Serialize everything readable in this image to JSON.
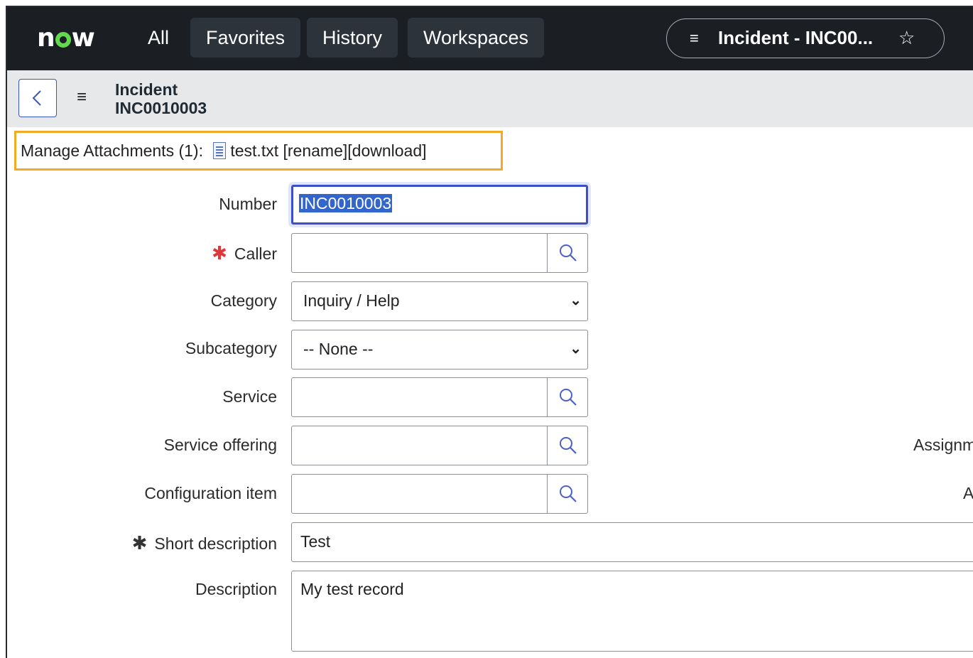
{
  "nav": {
    "logo_left": "n",
    "logo_right": "w",
    "items": [
      "All",
      "Favorites",
      "History",
      "Workspaces"
    ],
    "context_title": "Incident - INC00...",
    "context_star_icon": "star-outline-icon",
    "colors": {
      "bar": "#1b1f23",
      "accent": "#62d84e"
    }
  },
  "record": {
    "type": "Incident",
    "number": "INC0010003"
  },
  "attachments": {
    "label": "Manage Attachments (1):",
    "file": "test.txt",
    "rename": "[rename]",
    "download": "[download]"
  },
  "form": {
    "number_label": "Number",
    "number_value": "INC0010003",
    "caller_label": "Caller",
    "caller_value": "",
    "category_label": "Category",
    "category_value": "Inquiry / Help",
    "subcategory_label": "Subcategory",
    "subcategory_value": "-- None --",
    "service_label": "Service",
    "service_value": "",
    "service_offering_label": "Service offering",
    "service_offering_value": "",
    "ci_label": "Configuration item",
    "ci_value": "",
    "short_desc_label": "Short description",
    "short_desc_value": "Test",
    "description_label": "Description",
    "description_value": "My test record",
    "right_assignment_partial": "Assignm",
    "right_a_partial": "A",
    "required_marker": "✱"
  }
}
